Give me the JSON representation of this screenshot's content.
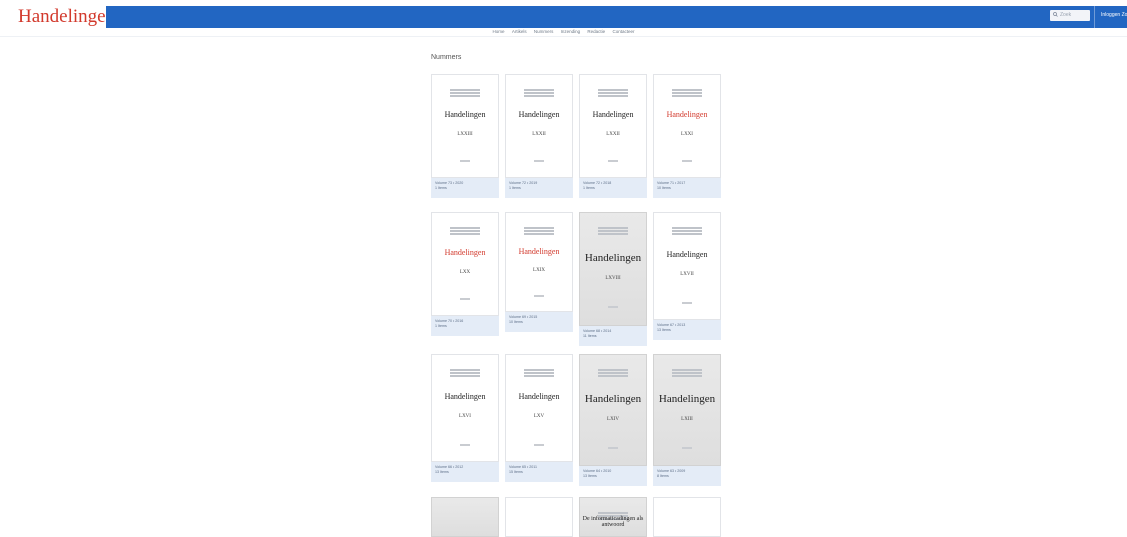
{
  "header": {
    "logo": "Handelingen",
    "search_placeholder": "Zoek",
    "user": "Inloggen  Zoek"
  },
  "nav": [
    "Home",
    "Artikels",
    "Nummers",
    "Inzending",
    "Redactie",
    "Contacteer"
  ],
  "page_title": "Nummers",
  "volumes": [
    {
      "title": "Handelingen",
      "volume": "LXXIII",
      "meta1": "Volume 73 • 2020",
      "meta2": "1 Items",
      "tone": "white",
      "red": false
    },
    {
      "title": "Handelingen",
      "volume": "LXXII",
      "meta1": "Volume 72 • 2019",
      "meta2": "1 Items",
      "tone": "white",
      "red": false
    },
    {
      "title": "Handelingen",
      "volume": "LXXII",
      "meta1": "Volume 72 • 2018",
      "meta2": "1 Items",
      "tone": "white",
      "red": false
    },
    {
      "title": "Handelingen",
      "volume": "LXXI",
      "meta1": "Volume 71 • 2017",
      "meta2": "10 Items",
      "tone": "white",
      "red": true
    },
    {
      "title": "Handelingen",
      "volume": "LXX",
      "meta1": "Volume 70 • 2016",
      "meta2": "1 Items",
      "tone": "white",
      "red": true
    },
    {
      "title": "Handelingen",
      "volume": "LXIX",
      "meta1": "Volume 69 • 2015",
      "meta2": "10 Items",
      "tone": "white",
      "red": true
    },
    {
      "title": "Handelingen",
      "volume": "LXVIII",
      "meta1": "Volume 68 • 2014",
      "meta2": "11 Items",
      "tone": "grey",
      "red": false
    },
    {
      "title": "Handelingen",
      "volume": "LXVII",
      "meta1": "Volume 67 • 2013",
      "meta2": "13 Items",
      "tone": "white",
      "red": false
    },
    {
      "title": "Handelingen",
      "volume": "LXVI",
      "meta1": "Volume 66 • 2012",
      "meta2": "13 Items",
      "tone": "white",
      "red": false
    },
    {
      "title": "Handelingen",
      "volume": "LXV",
      "meta1": "Volume 65 • 2011",
      "meta2": "15 Items",
      "tone": "white",
      "red": false
    },
    {
      "title": "Handelingen",
      "volume": "LXIV",
      "meta1": "Volume 64 • 2010",
      "meta2": "13 Items",
      "tone": "grey",
      "red": false
    },
    {
      "title": "Handelingen",
      "volume": "LXIII",
      "meta1": "Volume 63 • 2009",
      "meta2": "8 Items",
      "tone": "grey",
      "red": false
    },
    {
      "title": "",
      "volume": "",
      "meta1": "",
      "meta2": "",
      "tone": "grey",
      "red": false
    },
    {
      "title": "",
      "volume": "",
      "meta1": "",
      "meta2": "",
      "tone": "white",
      "red": false
    },
    {
      "title": "De informaticadingen als antwoord",
      "volume": "",
      "meta1": "",
      "meta2": "",
      "tone": "grey",
      "red": false
    },
    {
      "title": "",
      "volume": "",
      "meta1": "",
      "meta2": "",
      "tone": "white",
      "red": false
    }
  ],
  "colors": {
    "brand_red": "#d2392c",
    "header_blue": "#2266c2",
    "meta_bg": "#e4ecf7"
  }
}
